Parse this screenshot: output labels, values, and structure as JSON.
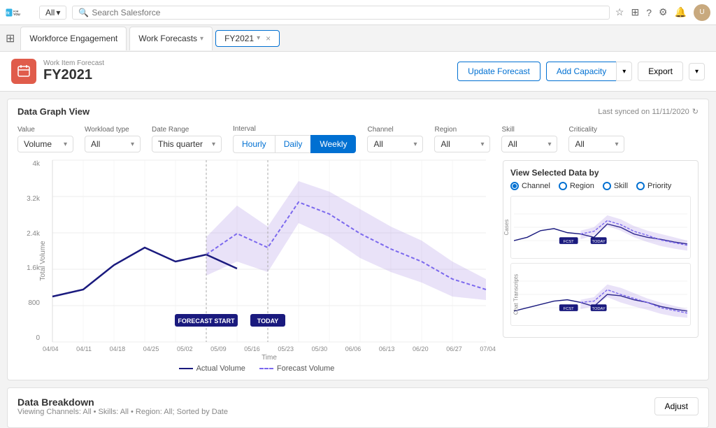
{
  "app": {
    "logo_text": "fit FOR YOU"
  },
  "top_nav": {
    "all_label": "All",
    "search_placeholder": "Search Salesforce"
  },
  "tab_bar": {
    "app_name": "Workforce Engagement",
    "tab1_label": "Work Forecasts",
    "tab2_label": "FY2021",
    "close_icon": "×"
  },
  "page_header": {
    "subtitle": "Work Item Forecast",
    "title": "FY2021",
    "update_btn": "Update Forecast",
    "add_btn": "Add Capacity",
    "export_btn": "Export"
  },
  "data_graph": {
    "section_title": "Data Graph View",
    "sync_text": "Last synced on 11/11/2020",
    "filters": {
      "value_label": "Value",
      "value_option": "Volume",
      "workload_label": "Workload type",
      "workload_option": "All",
      "daterange_label": "Date Range",
      "daterange_option": "This quarter",
      "interval_label": "Interval",
      "interval_hourly": "Hourly",
      "interval_daily": "Daily",
      "interval_weekly": "Weekly",
      "channel_label": "Channel",
      "channel_option": "All",
      "region_label": "Region",
      "region_option": "All",
      "skill_label": "Skill",
      "skill_option": "All",
      "criticality_label": "Criticality",
      "criticality_option": "All"
    },
    "y_axis_label": "Total Volume",
    "x_axis_labels": [
      "04/04",
      "04/11",
      "04/18",
      "04/25",
      "05/02",
      "05/09",
      "05/16",
      "05/23",
      "05/30",
      "06/06",
      "06/13",
      "06/20",
      "06/27",
      "07/04"
    ],
    "y_axis_values": [
      "0",
      "800",
      "1.6k",
      "2.4k",
      "3.2k",
      "4k"
    ],
    "forecast_start_label": "FORECAST START",
    "today_label": "TODAY",
    "x_axis_title": "Time",
    "legend_actual": "Actual Volume",
    "legend_forecast": "Forecast Volume"
  },
  "view_selected": {
    "title": "View Selected Data by",
    "options": [
      "Channel",
      "Region",
      "Skill",
      "Priority"
    ],
    "active_option": "Channel",
    "chart1_label": "Cases",
    "chart2_label": "Chat Transcripts"
  },
  "breakdown": {
    "title": "Data Breakdown",
    "subtitle": "Viewing Channels: All • Skills: All • Region: All; Sorted by Date",
    "adjust_btn": "Adjust"
  },
  "colors": {
    "primary": "#0070d2",
    "actual_line": "#1a1a7e",
    "forecast_line": "#7b68ee",
    "forecast_fill": "rgba(147, 112, 219, 0.25)",
    "header_icon_bg": "#e05c4b",
    "tab_active": "#0070d2"
  }
}
